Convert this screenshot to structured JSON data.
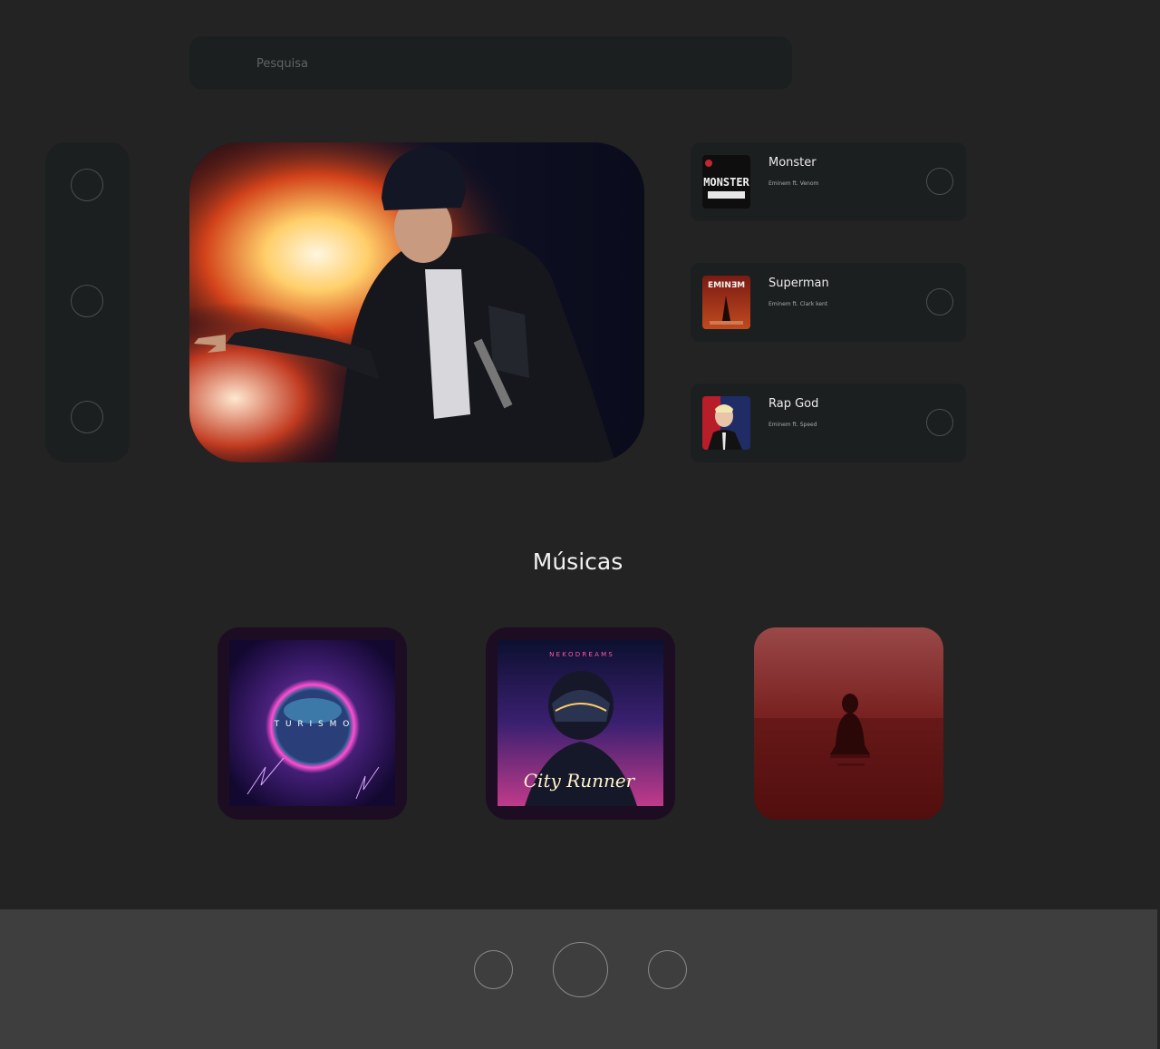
{
  "search": {
    "placeholder": "Pesquisa"
  },
  "nav": {
    "items": [
      {
        "icon": "nav-icon"
      },
      {
        "icon": "nav-icon"
      },
      {
        "icon": "nav-icon"
      }
    ]
  },
  "tracks": [
    {
      "title": "Monster",
      "artist": "Eminem ft. Venom",
      "cover_text": "MONSTER"
    },
    {
      "title": "Superman",
      "artist": "Eminem ft. Clark kent",
      "cover_text": "EMINƎM"
    },
    {
      "title": "Rap God",
      "artist": "Eminem ft. Speed"
    }
  ],
  "section": {
    "title": "Músicas"
  },
  "albums": [
    {
      "cover_text": "T U R I S M O"
    },
    {
      "cover_header": "N E K O   D R E A M S",
      "cover_text": "City Runner"
    },
    {
      "cover_text": ""
    }
  ],
  "player": {
    "controls": [
      "previous",
      "play",
      "next"
    ]
  },
  "colors": {
    "background": "#232323",
    "panel": "#1c1f20",
    "player_bar": "#3e3e3e",
    "album_frame": "#1d0d22"
  }
}
